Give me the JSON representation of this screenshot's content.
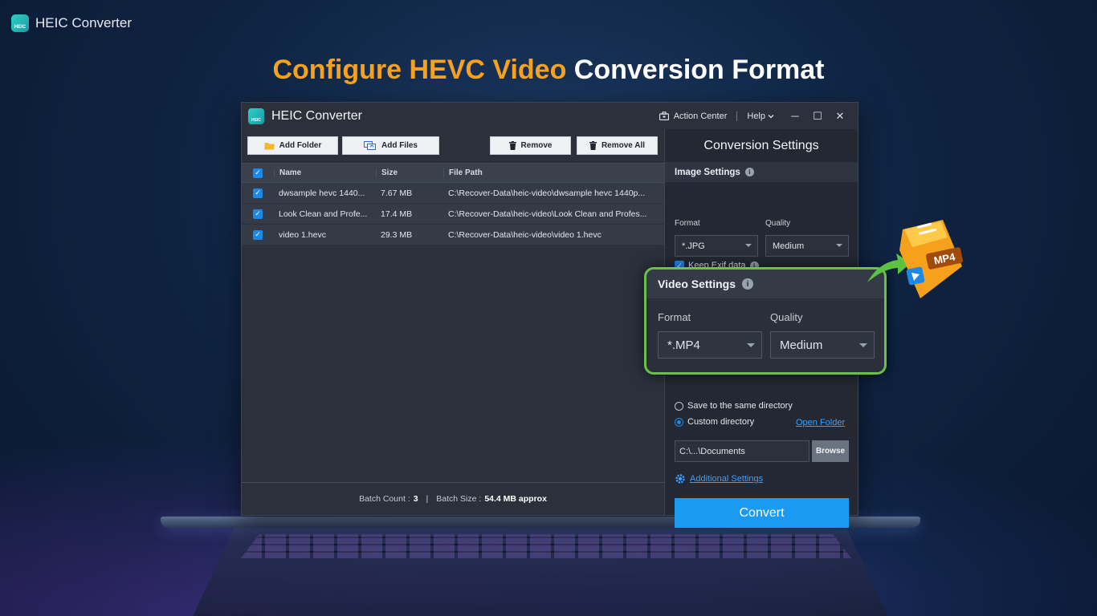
{
  "brand": {
    "name": "HEIC Converter",
    "logo_text": "HEIC"
  },
  "headline": {
    "highlight": "Configure HEVC Video",
    "rest": "Conversion Format"
  },
  "window": {
    "title": "HEIC Converter",
    "logo_text": "HEIC",
    "action_center": "Action Center",
    "help": "Help",
    "controls": {
      "minimize": "─",
      "maximize": "☐",
      "close": "✕"
    }
  },
  "toolbar": {
    "add_folder": "Add Folder",
    "add_files": "Add Files",
    "remove": "Remove",
    "remove_all": "Remove All"
  },
  "file_table": {
    "headers": {
      "name": "Name",
      "size": "Size",
      "path": "File Path"
    },
    "rows": [
      {
        "name": "dwsample hevc 1440...",
        "size": "7.67 MB",
        "path": "C:\\Recover-Data\\heic-video\\dwsample hevc 1440p...",
        "checked": true
      },
      {
        "name": "Look Clean and Profe...",
        "size": "17.4 MB",
        "path": "C:\\Recover-Data\\heic-video\\Look Clean and Profes...",
        "checked": true
      },
      {
        "name": "video 1.hevc",
        "size": "29.3 MB",
        "path": "C:\\Recover-Data\\heic-video\\video 1.hevc",
        "checked": true
      }
    ]
  },
  "status": {
    "batch_count_label": "Batch Count :",
    "batch_count": "3",
    "separator": "|",
    "batch_size_label": "Batch Size :",
    "batch_size": "54.4 MB approx"
  },
  "settings": {
    "title": "Conversion Settings",
    "image": {
      "heading": "Image Settings",
      "format_label": "Format",
      "format_value": "*.JPG",
      "quality_label": "Quality",
      "quality_value": "Medium",
      "keep_exif": "Keep Exif data"
    },
    "video": {
      "heading": "Video Settings",
      "format_label": "Format",
      "format_value": "*.MP4",
      "quality_label": "Quality",
      "quality_value": "Medium"
    },
    "output": {
      "same_dir": "Save to the same directory",
      "custom_dir": "Custom directory",
      "open_folder": "Open Folder",
      "dir_value": "C:\\...\\Documents",
      "browse": "Browse"
    },
    "additional": "Additional Settings",
    "convert": "Convert"
  },
  "badge": {
    "label": "MP4"
  },
  "colors": {
    "accent": "#f6a21e",
    "primary": "#1a9af0",
    "highlight_border": "#6cc04a"
  }
}
